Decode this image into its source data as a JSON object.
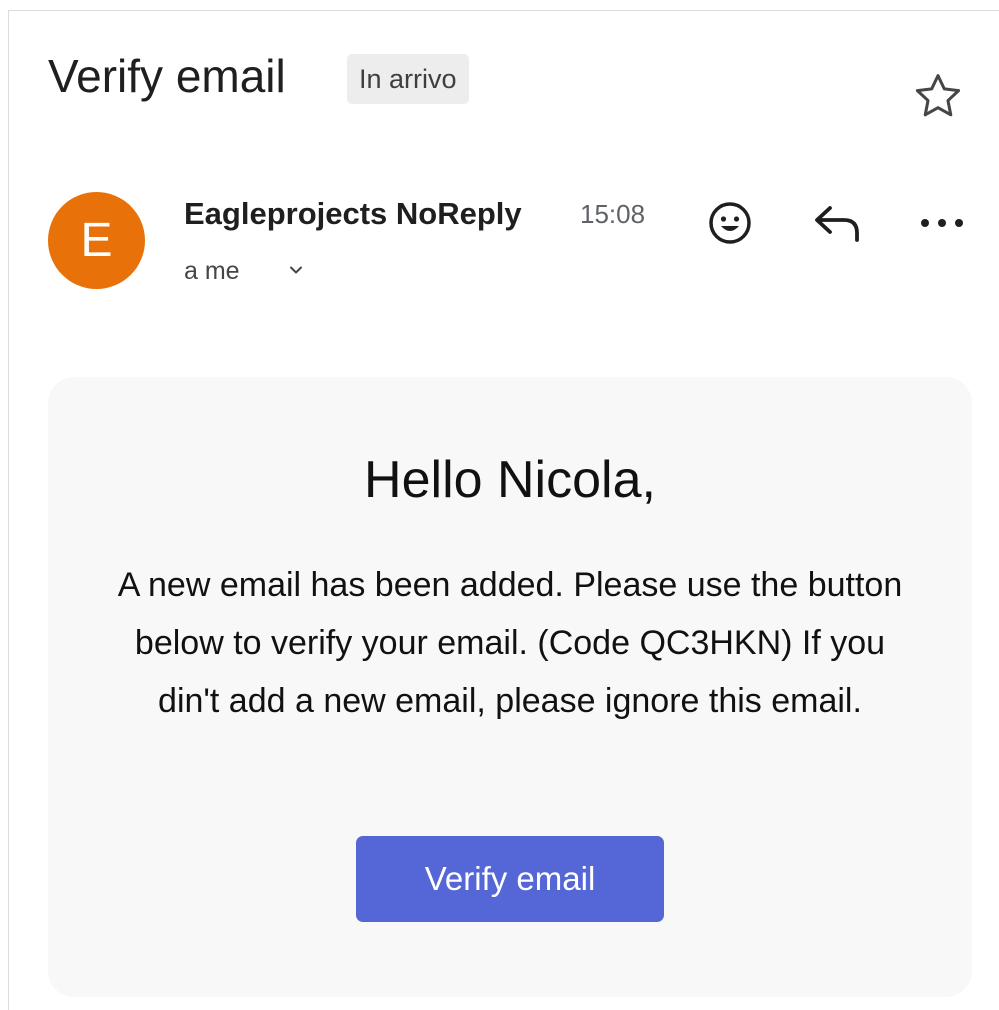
{
  "email": {
    "subject": "Verify email",
    "label": "In arrivo",
    "sender": {
      "initial": "E",
      "name": "Eagleprojects NoReply",
      "time": "15:08",
      "recipient": "a me",
      "avatar_color": "#e8710a"
    },
    "actions": {
      "star_icon": "star-outline-icon",
      "emoji_icon": "emoji-icon",
      "reply_icon": "reply-icon",
      "more_icon": "more-horizontal-icon",
      "recipient_details_icon": "chevron-down-icon"
    },
    "body": {
      "greeting": "Hello Nicola,",
      "message": "A new email has been added. Please use the button below to verify your email. (Code QC3HKN) If you din't add a new email, please ignore this email.",
      "button_label": "Verify email",
      "button_color": "#5567d6"
    }
  }
}
